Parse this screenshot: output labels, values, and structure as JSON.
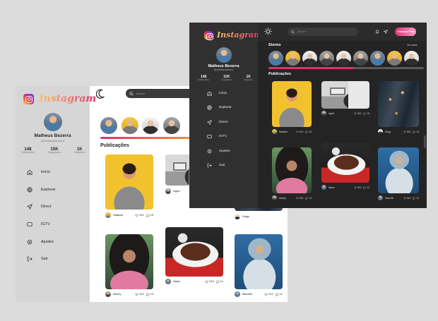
{
  "app": {
    "brand": "Instagram"
  },
  "light": {
    "search_placeholder": "Buscar",
    "profile": {
      "name": "Matheus Bezerra",
      "handle": "@matheusbezerra"
    },
    "stats": [
      {
        "value": "148",
        "label": "Publicações"
      },
      {
        "value": "15K",
        "label": "Seguidores"
      },
      {
        "value": "1K",
        "label": "Seguindo"
      }
    ],
    "nav": [
      {
        "label": "início",
        "icon": "home-icon"
      },
      {
        "label": "Explorar",
        "icon": "globe-icon"
      },
      {
        "label": "Direct",
        "icon": "send-icon"
      },
      {
        "label": "IGTV",
        "icon": "tv-icon"
      },
      {
        "label": "Ajustes",
        "icon": "gear-icon"
      },
      {
        "label": "Sair",
        "icon": "logout-icon"
      }
    ],
    "section_title": "Publicações",
    "posts": [
      {
        "user": "Natasha",
        "likes": "512",
        "comments": "15"
      },
      {
        "user": "Ingrid",
        "likes": "",
        "comments": ""
      },
      {
        "user": "Diego",
        "likes": "",
        "comments": ""
      },
      {
        "user": "Ashley",
        "likes": "512",
        "comments": "13"
      },
      {
        "user": "Natan",
        "likes": "513",
        "comments": "12"
      },
      {
        "user": "Marcelle",
        "likes": "512",
        "comments": "12"
      }
    ]
  },
  "dark": {
    "search_placeholder": "Buscar",
    "new_post_label": "Adicionar Post",
    "stories_title": "Stories",
    "see_all": "Ver todos",
    "profile": {
      "name": "Matheus Bezerra",
      "handle": "@matheusbezerra"
    },
    "stats": [
      {
        "value": "148",
        "label": "Publicações"
      },
      {
        "value": "15K",
        "label": "Seguidores"
      },
      {
        "value": "1K",
        "label": "Seguindo"
      }
    ],
    "nav": [
      {
        "label": "início",
        "icon": "home-icon"
      },
      {
        "label": "Explorar",
        "icon": "globe-icon"
      },
      {
        "label": "Direct",
        "icon": "send-icon"
      },
      {
        "label": "IGTV",
        "icon": "tv-icon"
      },
      {
        "label": "Ajustes",
        "icon": "gear-icon"
      },
      {
        "label": "Sair",
        "icon": "logout-icon"
      }
    ],
    "section_title": "Publicações",
    "posts": [
      {
        "user": "Natasha",
        "likes": "512",
        "comments": "15"
      },
      {
        "user": "Ingrid",
        "likes": "512",
        "comments": "15"
      },
      {
        "user": "Diego",
        "likes": "512",
        "comments": "15"
      },
      {
        "user": "Ashley",
        "likes": "512",
        "comments": "13"
      },
      {
        "user": "Natan",
        "likes": "513",
        "comments": "12"
      },
      {
        "user": "Marcelle",
        "likes": "512",
        "comments": "12"
      }
    ]
  },
  "colors": {
    "accent": "#e1306c",
    "accent2": "#fd8d32",
    "dark_bg": "#242424",
    "light_sidebar": "#d6d6d6"
  }
}
